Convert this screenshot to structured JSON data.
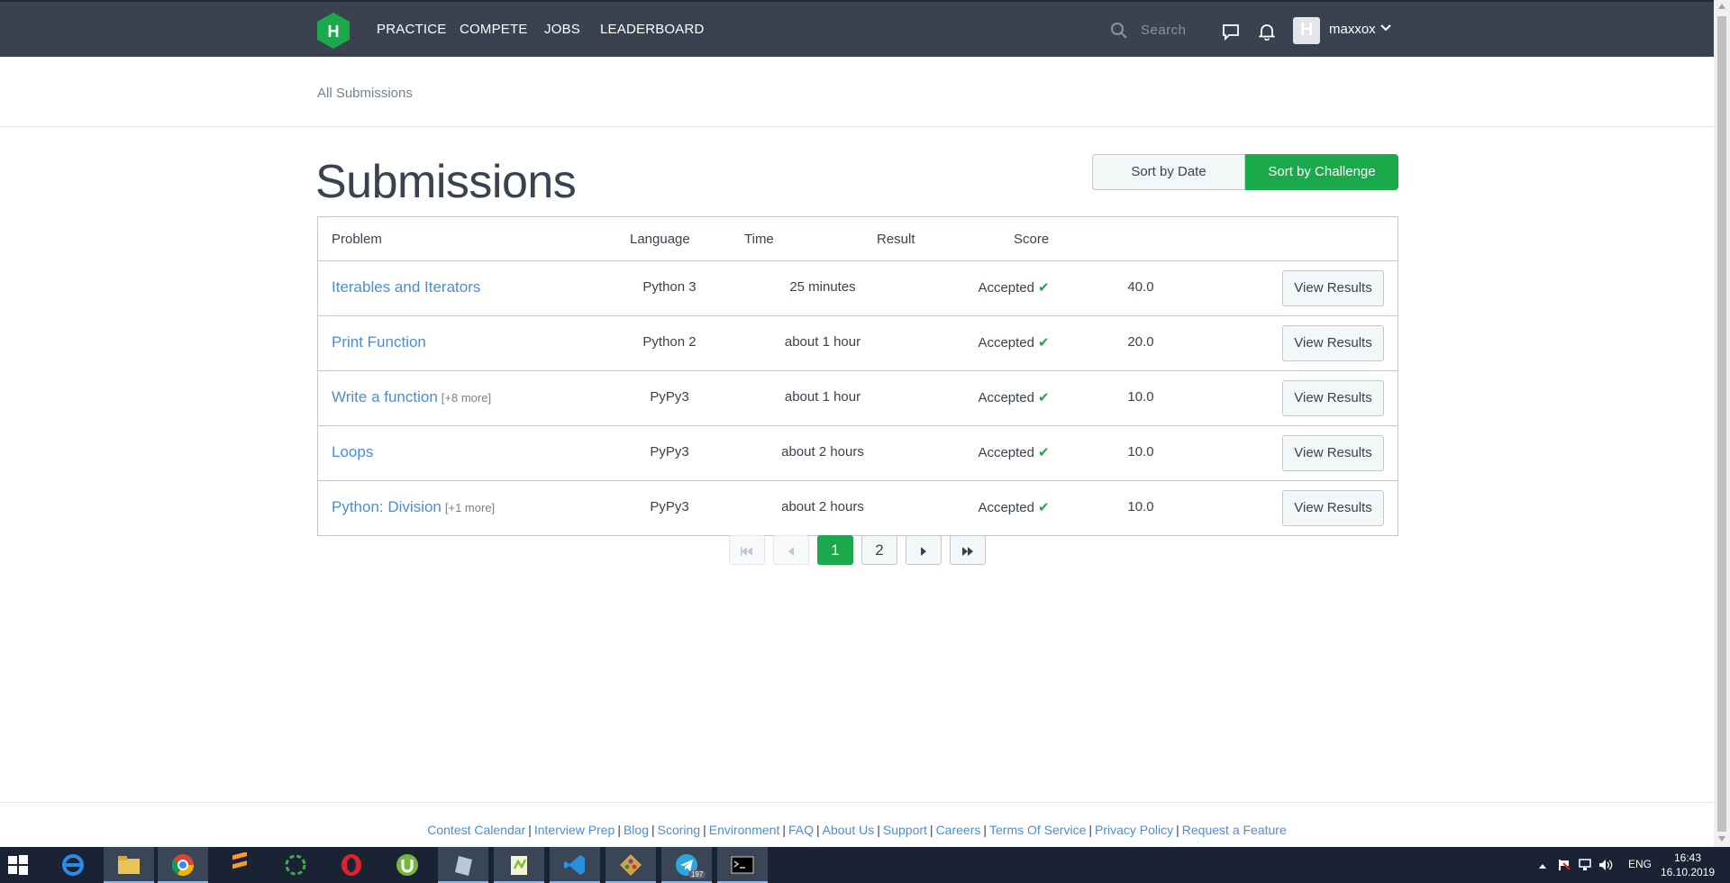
{
  "nav": {
    "logo_letter": "H",
    "links": [
      "PRACTICE",
      "COMPETE",
      "JOBS",
      "LEADERBOARD"
    ],
    "search_placeholder": "Search",
    "username": "maxxox",
    "avatar_letter": "H"
  },
  "breadcrumb": "All Submissions",
  "page": {
    "title": "Submissions",
    "sort_date": "Sort by Date",
    "sort_challenge": "Sort by Challenge"
  },
  "table": {
    "headers": {
      "problem": "Problem",
      "language": "Language",
      "time": "Time",
      "result": "Result",
      "score": "Score"
    },
    "rows": [
      {
        "problem": "Iterables and Iterators",
        "more": "",
        "language": "Python 3",
        "time": "25 minutes",
        "result": "Accepted",
        "score": "40.0",
        "action": "View Results"
      },
      {
        "problem": "Print Function",
        "more": "",
        "language": "Python 2",
        "time": "about 1 hour",
        "result": "Accepted",
        "score": "20.0",
        "action": "View Results"
      },
      {
        "problem": "Write a function",
        "more": "[+8 more]",
        "language": "PyPy3",
        "time": "about 1 hour",
        "result": "Accepted",
        "score": "10.0",
        "action": "View Results"
      },
      {
        "problem": "Loops",
        "more": "",
        "language": "PyPy3",
        "time": "about 2 hours",
        "result": "Accepted",
        "score": "10.0",
        "action": "View Results"
      },
      {
        "problem": "Python: Division",
        "more": "[+1 more]",
        "language": "PyPy3",
        "time": "about 2 hours",
        "result": "Accepted",
        "score": "10.0",
        "action": "View Results"
      }
    ]
  },
  "pagination": {
    "pages": [
      "1",
      "2"
    ],
    "current": "1"
  },
  "footer": {
    "links": [
      "Contest Calendar",
      "Interview Prep",
      "Blog",
      "Scoring",
      "Environment",
      "FAQ",
      "About Us",
      "Support",
      "Careers",
      "Terms Of Service",
      "Privacy Policy",
      "Request a Feature"
    ]
  },
  "taskbar": {
    "language": "ENG",
    "time": "16:43",
    "date": "16.10.2019",
    "telegram_badge": "197"
  },
  "colors": {
    "nav_bg": "#39424e",
    "accent_green": "#1ba94c",
    "link_blue": "#4a8ed1"
  }
}
